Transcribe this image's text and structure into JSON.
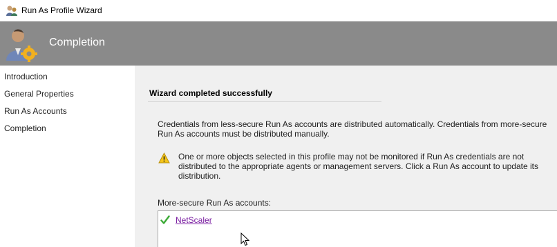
{
  "window": {
    "title": "Run As Profile Wizard",
    "app_icon": "run-as-profile-icon"
  },
  "header": {
    "heading": "Completion",
    "icon": "user-gear-icon"
  },
  "nav": {
    "items": [
      {
        "label": "Introduction"
      },
      {
        "label": "General Properties"
      },
      {
        "label": "Run As Accounts"
      },
      {
        "label": "Completion"
      }
    ]
  },
  "main": {
    "section_title": "Wizard completed successfully",
    "info_text": "Credentials from less-secure Run As accounts are distributed automatically. Credentials from more-secure Run As accounts must be distributed manually.",
    "warning_icon": "warning-icon",
    "warning_text": "One or more objects selected in this profile may not be monitored if Run As credentials are not distributed to the appropriate agents or management servers. Click a Run As account to update its distribution.",
    "list_label": "More-secure Run As accounts:",
    "accounts": [
      {
        "name": "NetScaler",
        "status_icon": "check-icon"
      }
    ]
  },
  "colors": {
    "header_bg": "#8a8a8a",
    "panel_bg": "#f0f0f0",
    "link": "#7a1ea1",
    "check": "#3aaa35",
    "warning": "#f5c518"
  }
}
